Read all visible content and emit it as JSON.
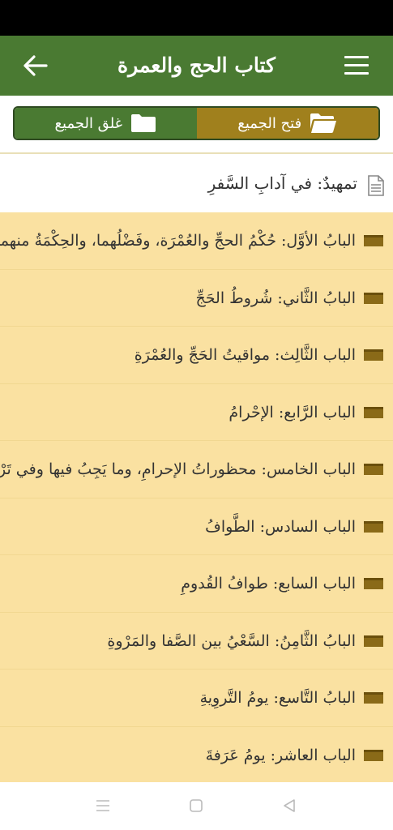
{
  "app_bar": {
    "title": "كتاب الحج والعمرة",
    "back_icon": "arrow-left-icon",
    "menu_icon": "hamburger-menu-icon"
  },
  "controls": {
    "open_all_label": "فتح الجميع",
    "close_all_label": "غلق الجميع",
    "open_color": "#a0801d",
    "close_color": "#4a7a32"
  },
  "intro": {
    "label": "تمهيدٌ: في آدابِ السَّفرِ",
    "icon": "document-icon"
  },
  "chapters": [
    {
      "label": "البابُ الأوَّل: حُكْمُ الحجِّ والعُمْرَة، وفَضْلُهما، والحِكْمَةُ منهما"
    },
    {
      "label": "البابُ الثَّاني: شُروطُ الحَجِّ"
    },
    {
      "label": "الباب الثَّالِث: مواقيتُ الحَجِّ والعُمْرَةِ"
    },
    {
      "label": "الباب الرَّابع: الإحْرامُ"
    },
    {
      "label": "الباب الخامس: محظوراتُ الإحرامِ، وما يَجِبُ فيها وفي تَرْكِ الـ..."
    },
    {
      "label": "الباب السادس: الطَّوافُ"
    },
    {
      "label": "الباب السابع: طوافُ القُدومِ"
    },
    {
      "label": "البابُ الثَّامِنُ: السَّعْيُ بين الصَّفا والمَرْوةِ"
    },
    {
      "label": "البابُ التَّاسع: يومُ التَّروِيةِ"
    },
    {
      "label": "الباب العاشر: يومُ عَرَفةَ"
    }
  ],
  "nav": {
    "recents_icon": "recents-icon",
    "home_icon": "home-icon",
    "back_icon": "nav-back-triangle-icon"
  },
  "colors": {
    "app_bar": "#4a7a32",
    "chapter_bg": "#fae1a1",
    "bullet": "#8a6a18"
  }
}
